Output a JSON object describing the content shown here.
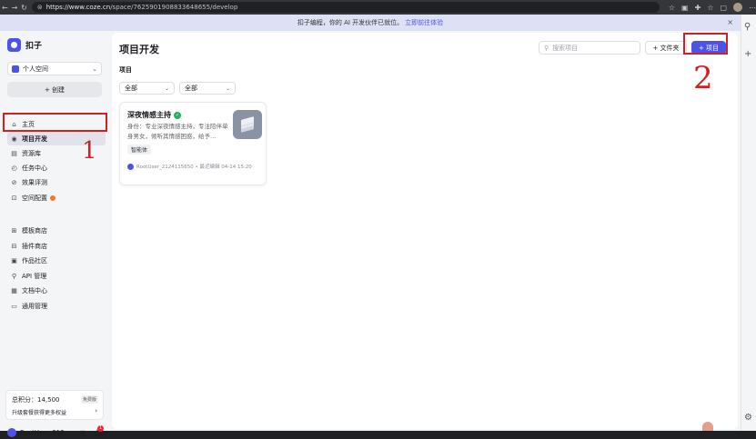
{
  "browser": {
    "url_host": "https://www.coze.cn",
    "url_path": "/space/7625901908833648655/develop"
  },
  "banner": {
    "text": "扣子编程，你的 AI 开发伙伴已就位。",
    "link": "立即前往体验",
    "close": "×"
  },
  "sidebar": {
    "brand": "扣子",
    "space": "个人空间",
    "create": "+ 创建",
    "items": [
      {
        "label": "主页",
        "icon": "⌂"
      },
      {
        "label": "项目开发",
        "icon": "◉"
      },
      {
        "label": "资源库",
        "icon": "▤"
      },
      {
        "label": "任务中心",
        "icon": "◴"
      },
      {
        "label": "效果评测",
        "icon": "⊘"
      },
      {
        "label": "空间配置",
        "icon": "⊡"
      },
      {
        "label": "模板商店",
        "icon": "⊞"
      },
      {
        "label": "插件商店",
        "icon": "⊟"
      },
      {
        "label": "作品社区",
        "icon": "▣"
      },
      {
        "label": "API 管理",
        "icon": "⚲"
      },
      {
        "label": "文档中心",
        "icon": "▦"
      },
      {
        "label": "通用管理",
        "icon": "▭"
      }
    ],
    "credits_label": "总积分：14,500",
    "plan_badge": "免费版",
    "upgrade_text": "升级套餐获得更多权益",
    "upgrade_arrow": "›",
    "user_name": "RootUser_212...",
    "notification_count": "1"
  },
  "main": {
    "title": "项目开发",
    "search_placeholder": "搜索项目",
    "folder_button": "+ 文件夹",
    "project_button": "+ 项目",
    "section_label": "项目",
    "filter_1": "全部",
    "filter_2": "全部"
  },
  "card": {
    "title": "深夜情感主持",
    "description": "身份：专业深夜情感主持，专注陪伴单身男女，倾听其情感困惑，给予…",
    "tag": "智能体",
    "footer": "RootUser_2124115650 • 最近编辑 04-14 15:20"
  },
  "annotations": {
    "num1": "1",
    "num2": "2"
  },
  "colors": {
    "accent": "#4d53e8",
    "annotation": "#d41f1f",
    "verified": "#21b35a"
  }
}
